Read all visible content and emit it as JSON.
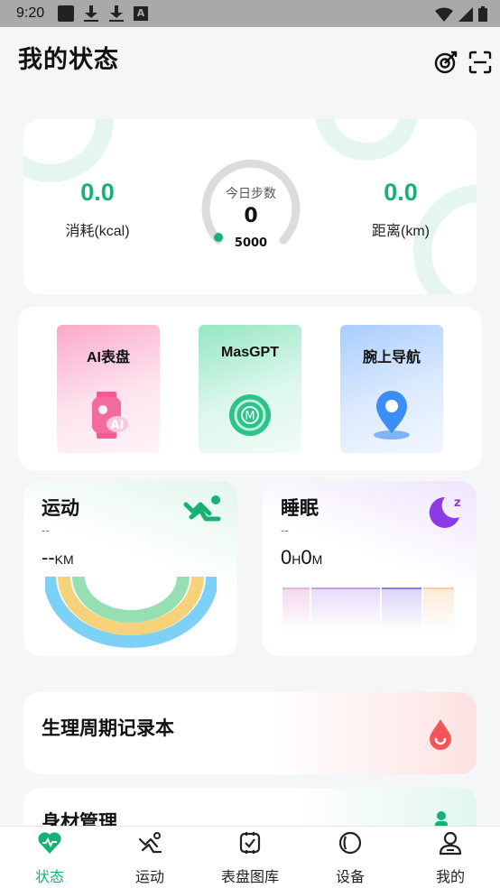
{
  "status_bar": {
    "time": "9:20"
  },
  "header": {
    "title": "我的状态"
  },
  "summary": {
    "calories": {
      "value": "0.0",
      "label": "消耗(kcal)"
    },
    "steps": {
      "title": "今日步数",
      "value": "0",
      "goal": "5000",
      "progress": 0
    },
    "distance": {
      "value": "0.0",
      "label": "距离(km)"
    }
  },
  "features": [
    {
      "label": "AI表盘",
      "icon": "ai-watch-icon"
    },
    {
      "label": "MasGPT",
      "icon": "gpt-icon"
    },
    {
      "label": "腕上导航",
      "icon": "location-pin-icon"
    }
  ],
  "sport": {
    "title": "运动",
    "subtitle": "--",
    "value": "--",
    "unit": "KM"
  },
  "sleep": {
    "title": "睡眠",
    "subtitle": "--",
    "hours": "0",
    "hours_unit": "H",
    "minutes": "0",
    "minutes_unit": "M"
  },
  "period": {
    "title": "生理周期记录本"
  },
  "body": {
    "title": "身材管理"
  },
  "tabs": [
    {
      "label": "状态",
      "icon": "heart-icon",
      "active": true
    },
    {
      "label": "运动",
      "icon": "sport-icon",
      "active": false
    },
    {
      "label": "表盘图库",
      "icon": "watchface-icon",
      "active": false
    },
    {
      "label": "设备",
      "icon": "device-icon",
      "active": false
    },
    {
      "label": "我的",
      "icon": "profile-icon",
      "active": false
    }
  ],
  "colors": {
    "accent": "#17b176",
    "background": "#f5f6f8"
  }
}
